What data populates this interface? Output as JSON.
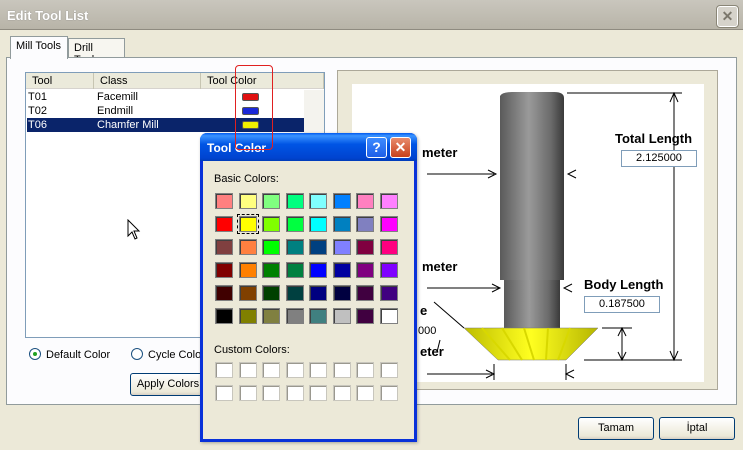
{
  "window": {
    "title": "Edit Tool List",
    "close_glyph": "✕"
  },
  "tabs": [
    {
      "label": "Mill Tools"
    },
    {
      "label": "Drill Tools"
    }
  ],
  "list": {
    "columns": [
      "Tool",
      "Class",
      "Tool Color"
    ],
    "rows": [
      {
        "tool": "T01",
        "class": "Facemill",
        "color": "#e01010"
      },
      {
        "tool": "T02",
        "class": "Endmill",
        "color": "#1a28d8"
      },
      {
        "tool": "T06",
        "class": "Chamfer Mill",
        "color": "#f0f000"
      }
    ]
  },
  "options": {
    "default_color": "Default Color",
    "cycle_color": "Cycle Color",
    "apply_colors": "Apply Colors"
  },
  "footer": {
    "ok": "Tamam",
    "cancel": "İptal"
  },
  "diagram": {
    "total_length_label": "Total Length",
    "total_length_value": "2.125000",
    "body_length_label": "Body Length",
    "body_length_value": "0.187500",
    "partial_diameter_1": "meter",
    "partial_diameter_2": "meter",
    "partial_angle": "e",
    "partial_angle_value": "000",
    "partial_diameter_3": "eter"
  },
  "color_dialog": {
    "title": "Tool Color",
    "help_glyph": "?",
    "close_glyph": "✕",
    "basic_colors_label": "Basic Colors:",
    "custom_colors_label": "Custom Colors:",
    "basic_colors": [
      [
        "#ff8080",
        "#ffff80",
        "#80ff80",
        "#00ff80",
        "#80ffff",
        "#0080ff",
        "#ff80c0",
        "#ff80ff"
      ],
      [
        "#ff0000",
        "#ffff00",
        "#80ff00",
        "#00ff40",
        "#00ffff",
        "#0080c0",
        "#8080c0",
        "#ff00ff"
      ],
      [
        "#804040",
        "#ff8040",
        "#00ff00",
        "#008080",
        "#004080",
        "#8080ff",
        "#800040",
        "#ff0080"
      ],
      [
        "#800000",
        "#ff8000",
        "#008000",
        "#008040",
        "#0000ff",
        "#0000a0",
        "#800080",
        "#8000ff"
      ],
      [
        "#400000",
        "#804000",
        "#004000",
        "#004040",
        "#000080",
        "#000040",
        "#400040",
        "#400080"
      ],
      [
        "#000000",
        "#808000",
        "#808040",
        "#808080",
        "#408080",
        "#c0c0c0",
        "#400040",
        "#ffffff"
      ]
    ],
    "selected": "row-1-col-1"
  }
}
